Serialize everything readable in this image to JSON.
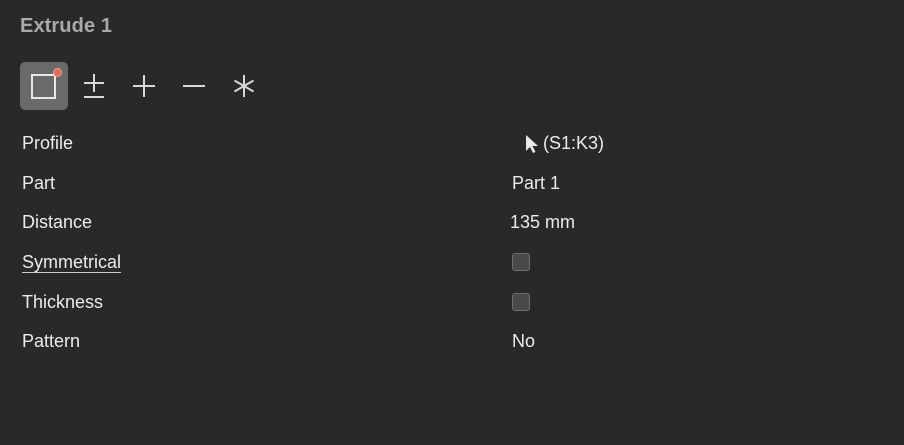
{
  "panel": {
    "title": "Extrude 1"
  },
  "toolbar": {
    "tools": [
      {
        "name": "new-body-icon",
        "active": true
      },
      {
        "name": "plus-minus-icon",
        "active": false
      },
      {
        "name": "plus-icon",
        "active": false
      },
      {
        "name": "minus-icon",
        "active": false
      },
      {
        "name": "asterisk-icon",
        "active": false
      }
    ],
    "accent": "#e06a5a"
  },
  "properties": {
    "profile": {
      "label": "Profile",
      "value": "(S1:K3)"
    },
    "part": {
      "label": "Part",
      "value": "Part 1"
    },
    "distance": {
      "label": "Distance",
      "value": "135 mm"
    },
    "symmetrical": {
      "label": "Symmetrical",
      "checked": false
    },
    "thickness": {
      "label": "Thickness",
      "checked": false
    },
    "pattern": {
      "label": "Pattern",
      "value": "No"
    }
  }
}
